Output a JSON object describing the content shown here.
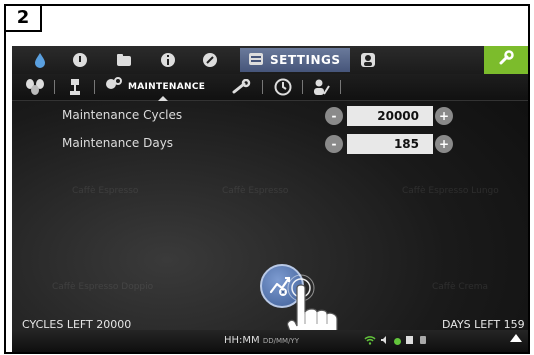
{
  "step_number": "2",
  "top_tabs": {
    "active_label": "SETTINGS"
  },
  "sub_tabs": {
    "active_label": "MAINTENANCE"
  },
  "settings": [
    {
      "label": "Maintenance Cycles",
      "value": "20000",
      "minus": "-",
      "plus": "+"
    },
    {
      "label": "Maintenance Days",
      "value": "185",
      "minus": "-",
      "plus": "+"
    }
  ],
  "background_products": [
    "Caffè Espresso",
    "Caffè Espresso",
    "Caffè Espresso Lungo",
    "Caffè Espresso Doppio",
    "Caffè Crema"
  ],
  "status": {
    "cycles_left": "CYCLES LEFT  20000",
    "days_left": "DAYS LEFT  159",
    "time": "HH:MM",
    "date": "DD/MM/YY"
  },
  "colors": {
    "active_tab": "#5a6a8d",
    "wrench_tab": "#7cbc2c",
    "status_ok": "#62c43b"
  }
}
